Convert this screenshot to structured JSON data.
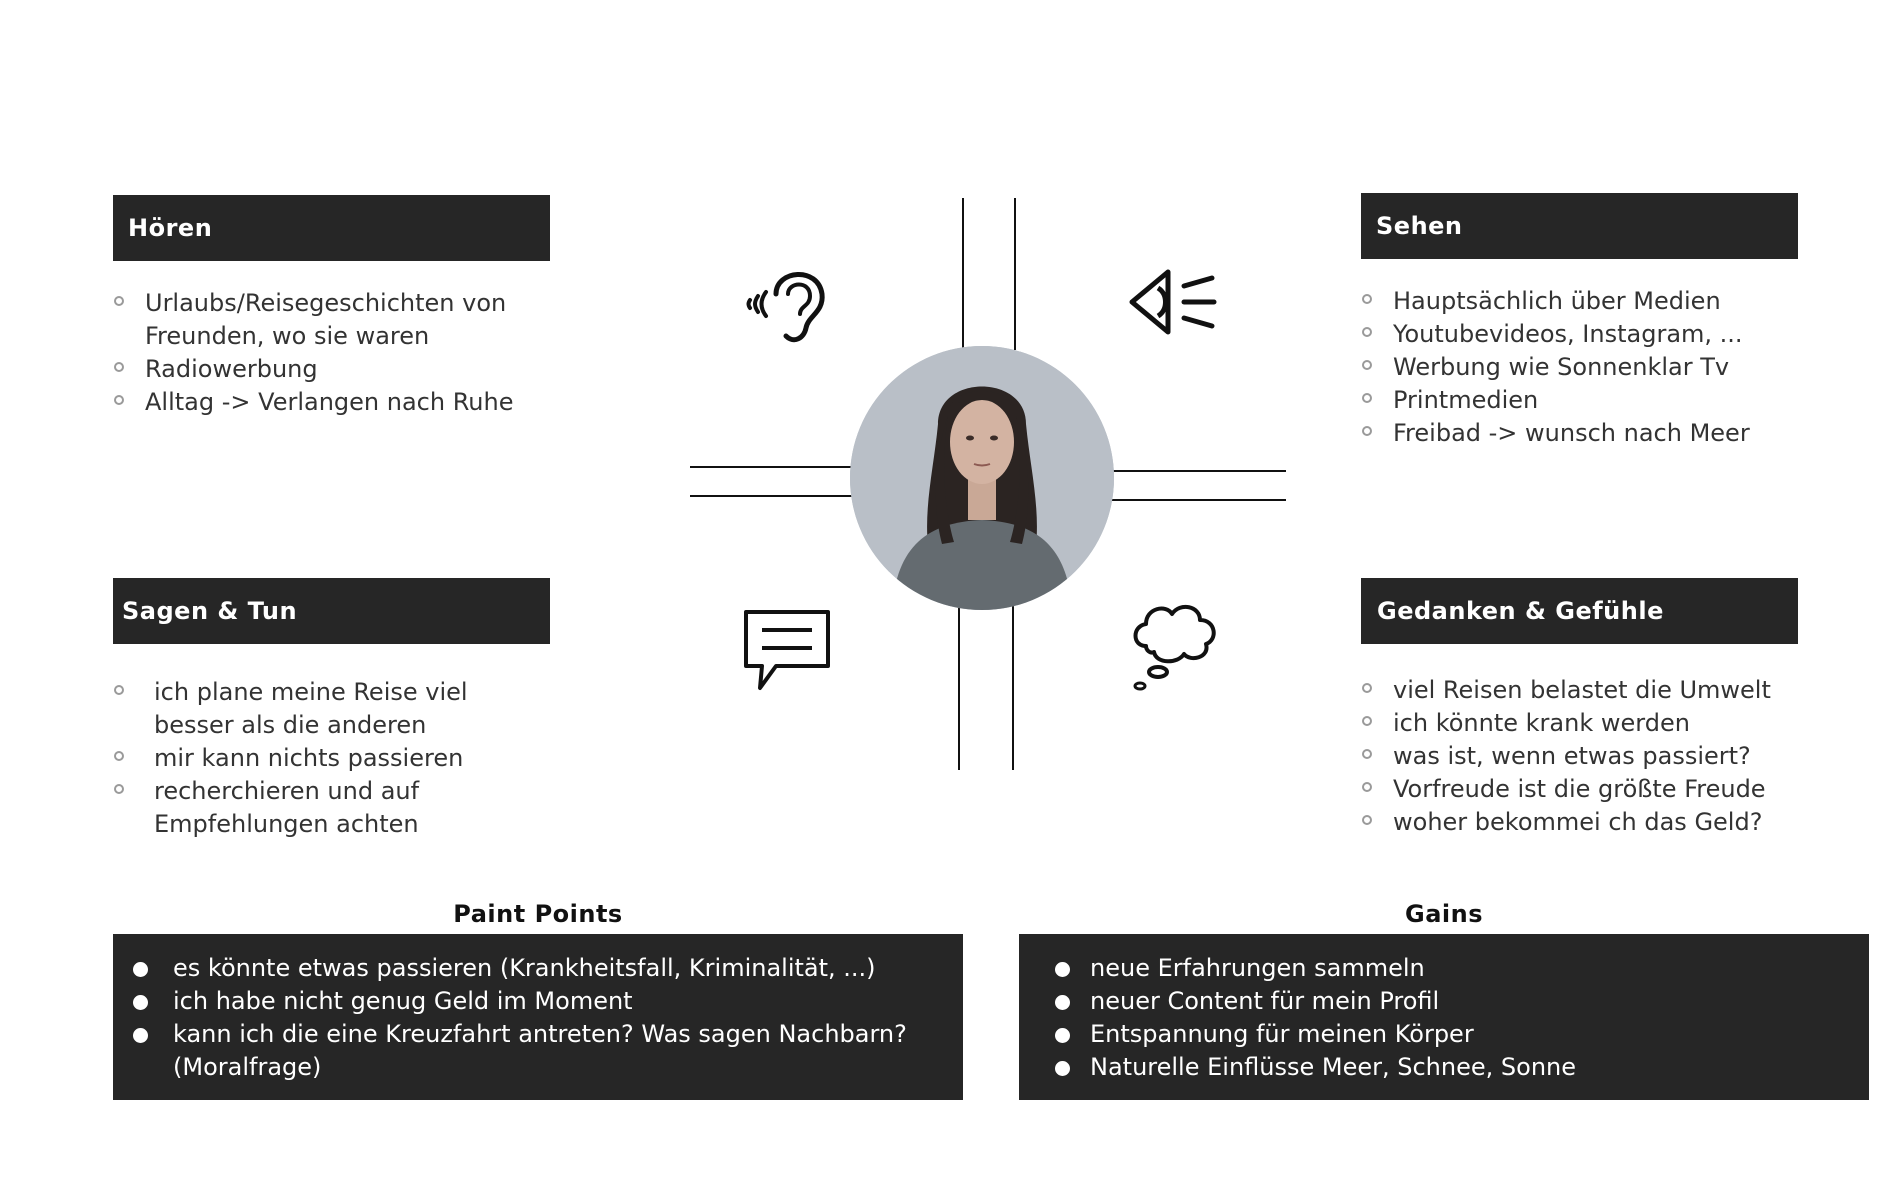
{
  "quadrants": {
    "hoeren": {
      "title": "Hören",
      "items": [
        "Urlaubs/Reisegeschichten von Freunden, wo sie waren",
        "Radiowerbung",
        "Alltag -> Verlangen nach Ruhe"
      ]
    },
    "sehen": {
      "title": "Sehen",
      "items": [
        "Hauptsächlich über Medien",
        "Youtubevideos, Instagram, ...",
        "Werbung wie Sonnenklar Tv",
        "Printmedien",
        "Freibad -> wunsch nach Meer"
      ]
    },
    "sagen_tun": {
      "title": "Sagen & Tun",
      "items": [
        "ich plane meine Reise viel besser als die anderen",
        "mir kann nichts passieren",
        "recherchieren und auf Empfehlungen achten"
      ]
    },
    "gedanken": {
      "title": "Gedanken & Gefühle",
      "items": [
        "viel Reisen belastet die Umwelt",
        "ich könnte krank werden",
        "was ist, wenn etwas passiert?",
        "Vorfreude ist die größte Freude",
        "woher bekommei ch das Geld?"
      ]
    }
  },
  "icons": {
    "ear": "ear-icon",
    "eye": "eye-icon",
    "speech": "speech-bubble-icon",
    "thought": "thought-bubble-icon"
  },
  "pain_points": {
    "title": "Paint Points",
    "items": [
      "es könnte etwas passieren (Krankheitsfall, Kriminalität, ...)",
      "ich habe nicht genug Geld im Moment",
      "kann ich die eine Kreuzfahrt antreten? Was sagen Nachbarn? (Moralfrage)"
    ]
  },
  "gains": {
    "title": "Gains",
    "items": [
      "neue Erfahrungen sammeln",
      "neuer Content für mein Profil",
      "Entspannung für meinen Körper",
      "Naturelle Einflüsse Meer, Schnee, Sonne"
    ]
  },
  "colors": {
    "header_bg": "#262626",
    "header_text": "#ffffff",
    "portrait_bg": "#b9bfc7"
  }
}
